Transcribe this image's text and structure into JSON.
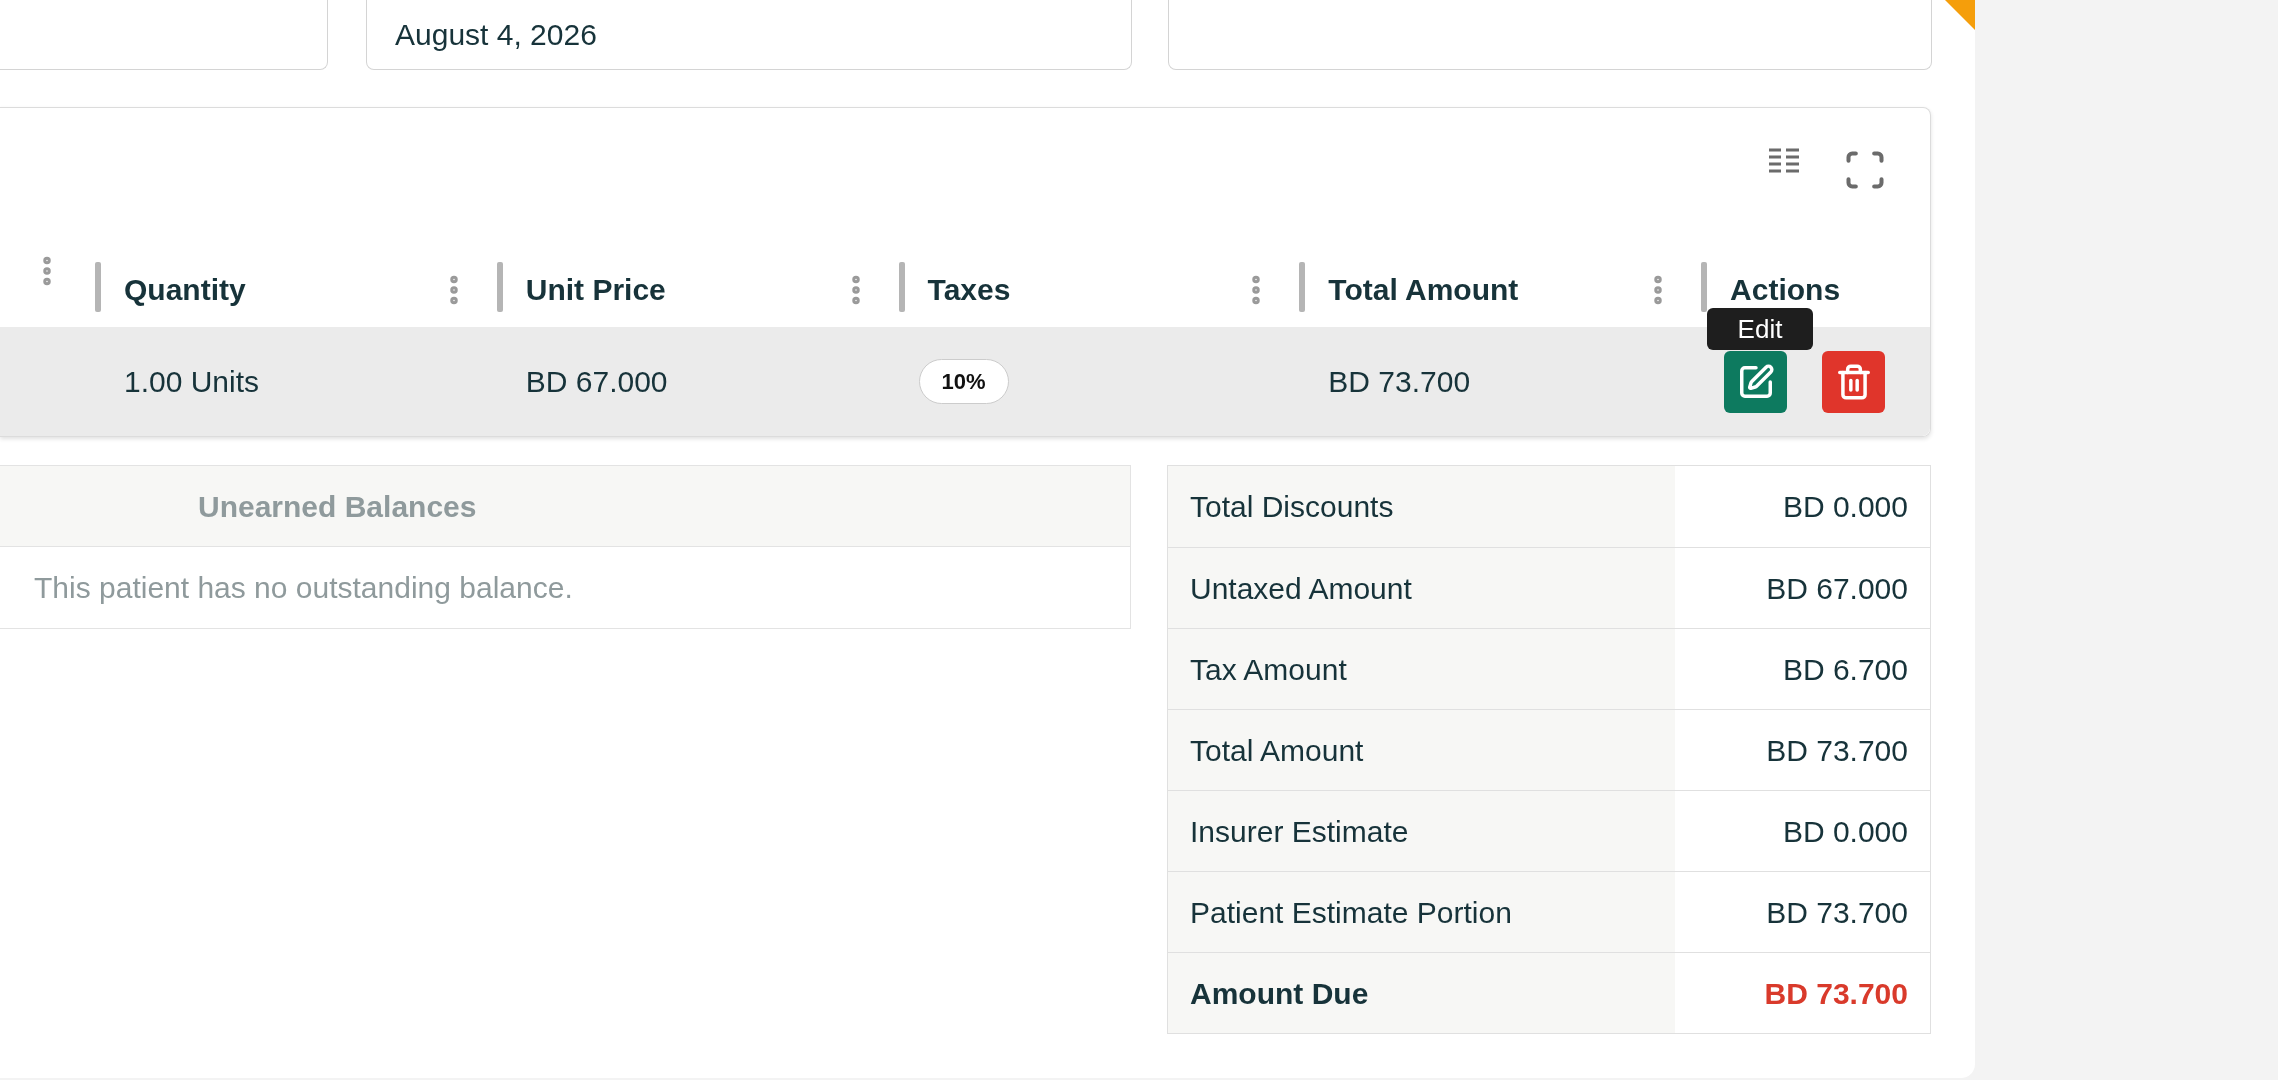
{
  "date_field": {
    "value": "August 4, 2026"
  },
  "order_lines": {
    "columns": [
      {
        "label": "Quantity"
      },
      {
        "label": "Unit Price"
      },
      {
        "label": "Taxes"
      },
      {
        "label": "Total Amount"
      },
      {
        "label": "Actions"
      }
    ],
    "rows": [
      {
        "cells": [
          {
            "kind": "text",
            "text": "1.00 Units"
          },
          {
            "kind": "text",
            "text": "BD 67.000"
          },
          {
            "kind": "badge",
            "text": "10%"
          },
          {
            "kind": "text",
            "text": "BD 73.700"
          },
          {
            "kind": "actions",
            "tooltip": "Edit"
          }
        ]
      }
    ]
  },
  "unearned_balances": {
    "title": "Unearned Balances",
    "message": "This patient has no outstanding balance."
  },
  "summary": [
    {
      "label": "Total Discounts",
      "value": "BD 0.000",
      "kind": "normal"
    },
    {
      "label": "Untaxed Amount",
      "value": "BD 67.000",
      "kind": "normal"
    },
    {
      "label": "Tax Amount",
      "value": "BD 6.700",
      "kind": "normal"
    },
    {
      "label": "Total Amount",
      "value": "BD 73.700",
      "kind": "normal"
    },
    {
      "label": "Insurer Estimate",
      "value": "BD 0.000",
      "kind": "normal"
    },
    {
      "label": "Patient Estimate Portion",
      "value": "BD 73.700",
      "kind": "normal"
    },
    {
      "label": "Amount Due",
      "value": "BD 73.700",
      "kind": "due"
    }
  ]
}
